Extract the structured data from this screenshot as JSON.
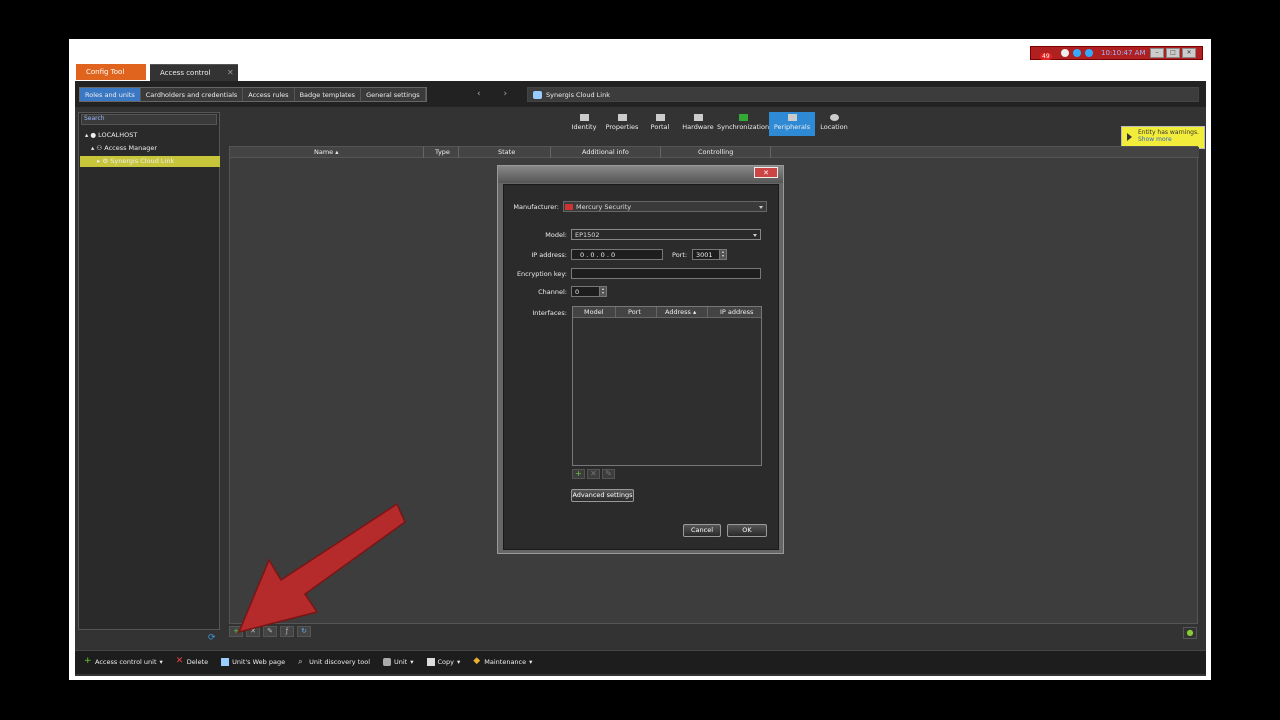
{
  "window": {
    "tabs": [
      {
        "label": "Config Tool"
      },
      {
        "label": "Access control"
      }
    ],
    "tray": {
      "badge": "49",
      "clock": "10:10:47 AM"
    },
    "win_buttons": [
      "–",
      "□",
      "✕"
    ]
  },
  "nav": {
    "tabs": [
      {
        "label": "Roles and units"
      },
      {
        "label": "Cardholders and credentials"
      },
      {
        "label": "Access rules"
      },
      {
        "label": "Badge templates"
      },
      {
        "label": "General settings"
      }
    ],
    "arrows": "‹ ›",
    "entity": "Synergis Cloud Link"
  },
  "left": {
    "search_placeholder": "Search",
    "tree": [
      {
        "label": "LOCALHOST"
      },
      {
        "label": "Access Manager"
      },
      {
        "label": "Synergis Cloud Link"
      }
    ]
  },
  "subtabs": [
    {
      "label": "Identity"
    },
    {
      "label": "Properties"
    },
    {
      "label": "Portal"
    },
    {
      "label": "Hardware"
    },
    {
      "label": "Synchronization"
    },
    {
      "label": "Peripherals"
    },
    {
      "label": "Location"
    }
  ],
  "warning": {
    "text": "Entity has warnings.",
    "link": "Show more"
  },
  "grid": {
    "columns": [
      "Name ▴",
      "Type",
      "State",
      "Additional info",
      "Controlling"
    ]
  },
  "dialog": {
    "manufacturer_label": "Manufacturer:",
    "manufacturer_value": "Mercury Security",
    "model_label": "Model:",
    "model_value": "EP1502",
    "ip_label": "IP address:",
    "ip_value": "0 . 0 . 0 . 0",
    "port_label": "Port:",
    "port_value": "3001",
    "encryption_label": "Encryption key:",
    "encryption_value": "",
    "channel_label": "Channel:",
    "channel_value": "0",
    "interfaces_label": "Interfaces:",
    "interface_columns": [
      "Model",
      "Port",
      "Address ▴",
      "IP address"
    ],
    "advanced_button": "Advanced settings",
    "cancel_button": "Cancel",
    "ok_button": "OK"
  },
  "actions": [
    {
      "label": "Access control unit",
      "dropdown": "▾"
    },
    {
      "label": "Delete"
    },
    {
      "label": "Unit's Web page"
    },
    {
      "label": "Unit discovery tool"
    },
    {
      "label": "Unit",
      "dropdown": "▾"
    },
    {
      "label": "Copy",
      "dropdown": "▾"
    },
    {
      "label": "Maintenance",
      "dropdown": "▾"
    }
  ],
  "colors": {
    "accent_orange": "#e0641d",
    "accent_blue": "#2f8ad6",
    "selection": "#c7c53a",
    "warning": "#f2ec3a",
    "arrow": "#b52a2a"
  }
}
